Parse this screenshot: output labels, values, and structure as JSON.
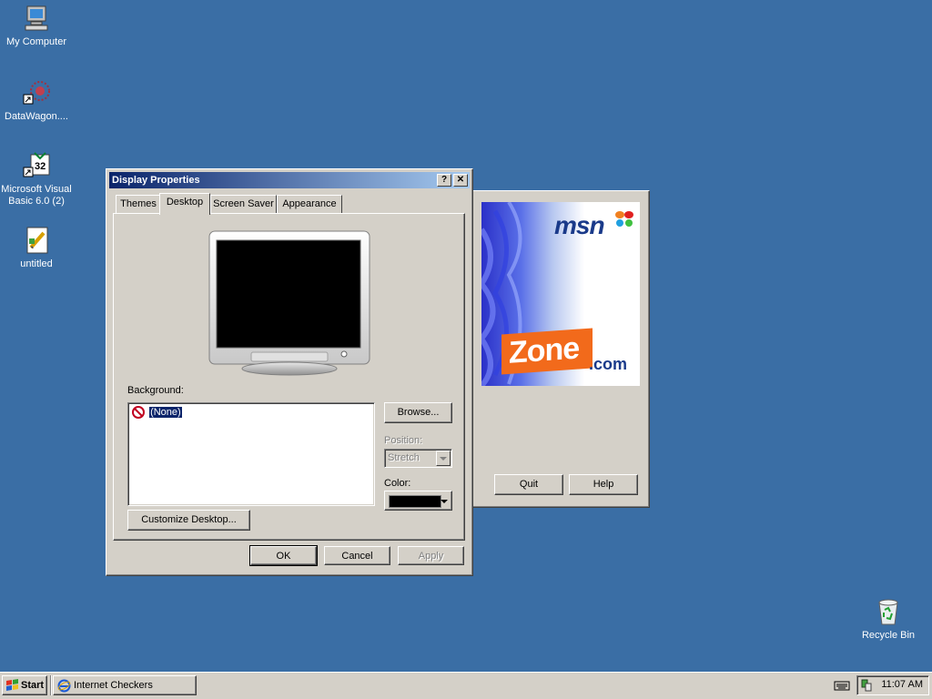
{
  "desktop": {
    "icons": [
      {
        "label": "My Computer",
        "icon": "my-computer-icon"
      },
      {
        "label": "DataWagon....",
        "icon": "datawagon-shortcut-icon"
      },
      {
        "label": "Microsoft Visual Basic 6.0 (2)",
        "icon": "visual-basic-shortcut-icon"
      },
      {
        "label": "untitled",
        "icon": "paint-document-icon"
      },
      {
        "label": "Recycle Bin",
        "icon": "recycle-bin-icon"
      }
    ]
  },
  "display_properties": {
    "title": "Display Properties",
    "help_button": "?",
    "close_button": "✕",
    "tabs": [
      "Themes",
      "Desktop",
      "Screen Saver",
      "Appearance"
    ],
    "active_tab": "Desktop",
    "background_label": "Background:",
    "background_items": [
      {
        "label": "(None)",
        "icon": "none-icon",
        "selected": true
      }
    ],
    "browse_button": "Browse...",
    "position_label": "Position:",
    "position_value": "Stretch",
    "color_label": "Color:",
    "color_value": "#000000",
    "customize_button": "Customize Desktop...",
    "ok_button": "OK",
    "cancel_button": "Cancel",
    "apply_button": "Apply"
  },
  "zone_window": {
    "msn_text": "msn",
    "zone_text": "Zone",
    "dotcom_text": ".com",
    "quit_button": "Quit",
    "help_button": "Help"
  },
  "taskbar": {
    "start_label": "Start",
    "task_label": "Internet Checkers",
    "clock": "11:07 AM"
  },
  "colors": {
    "desktop": "#3a6ea5",
    "title_active_start": "#0a246a",
    "title_active_end": "#a6caf0",
    "face": "#d4d0c8"
  }
}
